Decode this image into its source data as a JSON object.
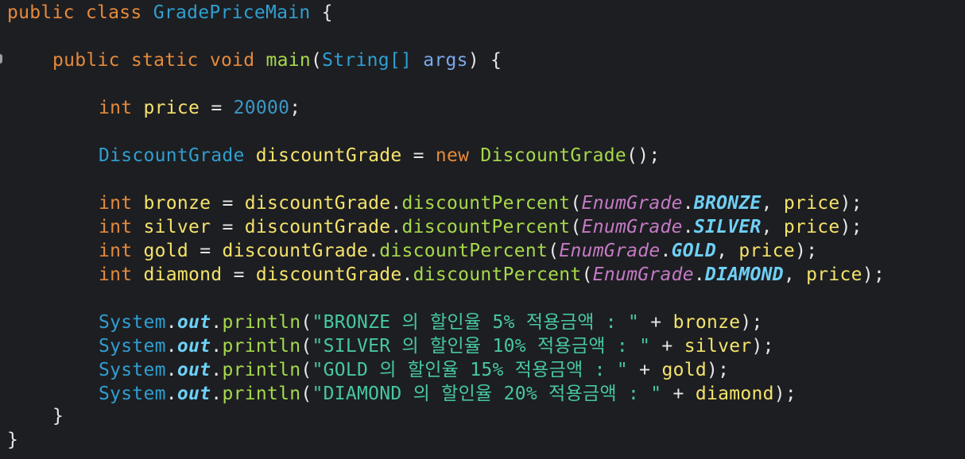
{
  "code": {
    "l1": {
      "kw1": "public",
      "kw2": "class",
      "class_name": "GradePriceMain",
      "brace": "{"
    },
    "l2": {
      "kw1": "public",
      "kw2": "static",
      "kw3": "void",
      "method": "main",
      "open": "(",
      "ptype": "String[]",
      "param": "args",
      "close": ")",
      "brace": "{"
    },
    "l3": {
      "type": "int",
      "var": "price",
      "eq": "=",
      "num": "20000",
      "semi": ";"
    },
    "l4": {
      "type": "DiscountGrade",
      "var": "discountGrade",
      "eq": "=",
      "kw": "new",
      "ctor": "DiscountGrade",
      "tail": "();"
    },
    "calls": [
      {
        "type": "int",
        "var": "bronze",
        "eq": "=",
        "obj": "discountGrade",
        "dot": ".",
        "method": "discountPercent",
        "open": "(",
        "enum_cls": "EnumGrade",
        "enum_dot": ".",
        "enum_const": "BRONZE",
        "comma": ",",
        "arg": "price",
        "close": ");"
      },
      {
        "type": "int",
        "var": "silver",
        "eq": "=",
        "obj": "discountGrade",
        "dot": ".",
        "method": "discountPercent",
        "open": "(",
        "enum_cls": "EnumGrade",
        "enum_dot": ".",
        "enum_const": "SILVER",
        "comma": ",",
        "arg": "price",
        "close": ");"
      },
      {
        "type": "int",
        "var": "gold",
        "eq": "=",
        "obj": "discountGrade",
        "dot": ".",
        "method": "discountPercent",
        "open": "(",
        "enum_cls": "EnumGrade",
        "enum_dot": ".",
        "enum_const": "GOLD",
        "comma": ",",
        "arg": "price",
        "close": ");"
      },
      {
        "type": "int",
        "var": "diamond",
        "eq": "=",
        "obj": "discountGrade",
        "dot": ".",
        "method": "discountPercent",
        "open": "(",
        "enum_cls": "EnumGrade",
        "enum_dot": ".",
        "enum_const": "DIAMOND",
        "comma": ",",
        "arg": "price",
        "close": ");"
      }
    ],
    "prints": [
      {
        "sys": "System",
        "dot1": ".",
        "out": "out",
        "dot2": ".",
        "fn": "println",
        "open": "(",
        "str": "\"BRONZE 의 할인율 5% 적용금액 : \"",
        "plus": "+",
        "var": "bronze",
        "close": ");"
      },
      {
        "sys": "System",
        "dot1": ".",
        "out": "out",
        "dot2": ".",
        "fn": "println",
        "open": "(",
        "str": "\"SILVER 의 할인율 10% 적용금액 : \"",
        "plus": "+",
        "var": "silver",
        "close": ");"
      },
      {
        "sys": "System",
        "dot1": ".",
        "out": "out",
        "dot2": ".",
        "fn": "println",
        "open": "(",
        "str": "\"GOLD 의 할인율 15% 적용금액 : \"",
        "plus": "+",
        "var": "gold",
        "close": ");"
      },
      {
        "sys": "System",
        "dot1": ".",
        "out": "out",
        "dot2": ".",
        "fn": "println",
        "open": "(",
        "str": "\"DIAMOND 의 할인율 20% 적용금액 : \"",
        "plus": "+",
        "var": "diamond",
        "close": ");"
      }
    ],
    "close_method": "}",
    "close_class": "}"
  }
}
